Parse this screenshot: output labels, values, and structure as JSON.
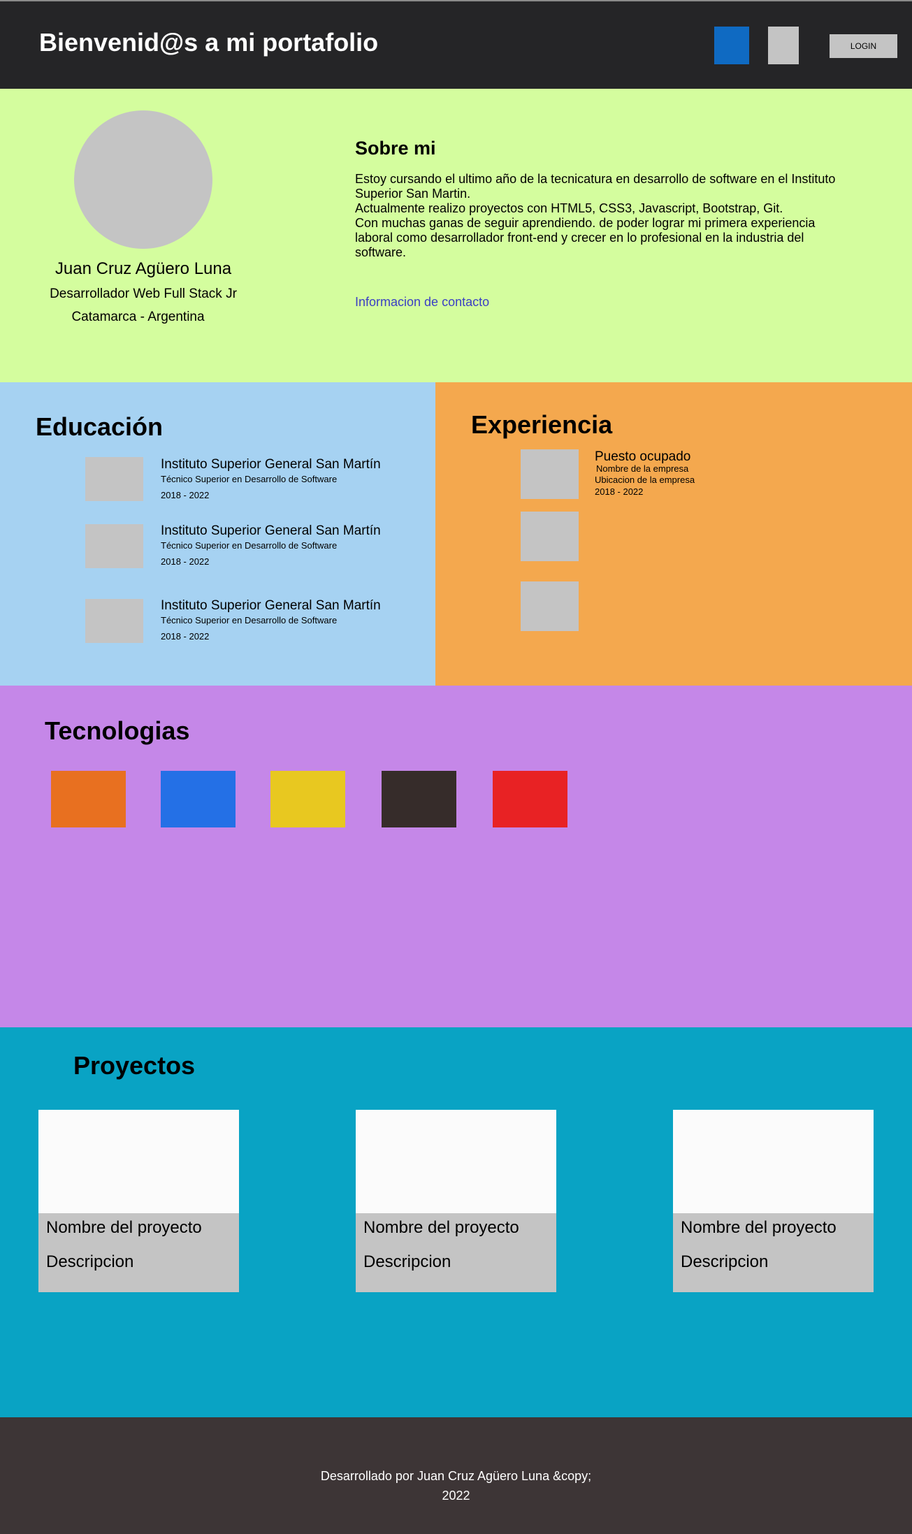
{
  "header": {
    "title": "Bienvenid@s a mi portafolio",
    "login_label": "LOGIN",
    "colors": {
      "background": "#252527",
      "social_primary": "#0f6ac2",
      "social_secondary": "#c4c4c4"
    }
  },
  "about": {
    "name": "Juan Cruz Agüero Luna",
    "role": "Desarrollador Web Full Stack Jr",
    "location": "Catamarca - Argentina",
    "heading": "Sobre mi",
    "paragraph_lines": [
      "Estoy cursando el ultimo año de la tecnicatura en desarrollo de software en el Instituto",
      "Superior San Martin.",
      "Actualmente realizo proyectos con HTML5, CSS3, Javascript, Bootstrap, Git.",
      "Con muchas ganas de seguir aprendiendo. de poder lograr mi primera experiencia",
      "laboral como desarrollador front-end y crecer en lo profesional en la industria del",
      "software."
    ],
    "contact_link": "Informacion de contacto",
    "colors": {
      "background": "#d4fd9e",
      "link": "#3a3fc4"
    }
  },
  "education": {
    "heading": "Educación",
    "items": [
      {
        "institution": "Instituto Superior General San Martín",
        "degree": "Técnico Superior en Desarrollo de Software",
        "dates": "2018 - 2022"
      },
      {
        "institution": "Instituto Superior General San Martín",
        "degree": "Técnico Superior en Desarrollo de Software",
        "dates": "2018 - 2022"
      },
      {
        "institution": "Instituto Superior General San Martín",
        "degree": "Técnico Superior en Desarrollo de Software",
        "dates": "2018 - 2022"
      }
    ],
    "colors": {
      "background": "#a6d2f2"
    }
  },
  "experience": {
    "heading": "Experiencia",
    "position": "Puesto ocupado",
    "company": "Nombre de la empresa",
    "company_location": "Ubicacion de la empresa",
    "dates": "2018 - 2022",
    "colors": {
      "background": "#f4a84e"
    }
  },
  "technologies": {
    "heading": "Tecnologias",
    "tiles": [
      {
        "color": "#e87020"
      },
      {
        "color": "#2470e6"
      },
      {
        "color": "#e8c820"
      },
      {
        "color": "#362c2a"
      },
      {
        "color": "#e82224"
      }
    ],
    "colors": {
      "background": "#c587e8"
    }
  },
  "projects": {
    "heading": "Proyectos",
    "cards": [
      {
        "name": "Nombre del proyecto",
        "description": "Descripcion"
      },
      {
        "name": "Nombre del proyecto",
        "description": "Descripcion"
      },
      {
        "name": "Nombre del proyecto",
        "description": "Descripcion"
      }
    ],
    "colors": {
      "background": "#09a3c4"
    }
  },
  "footer": {
    "line1": "Desarrollado por Juan Cruz Agüero Luna &copy;",
    "line2": "2022",
    "colors": {
      "background": "#3d3536"
    }
  }
}
